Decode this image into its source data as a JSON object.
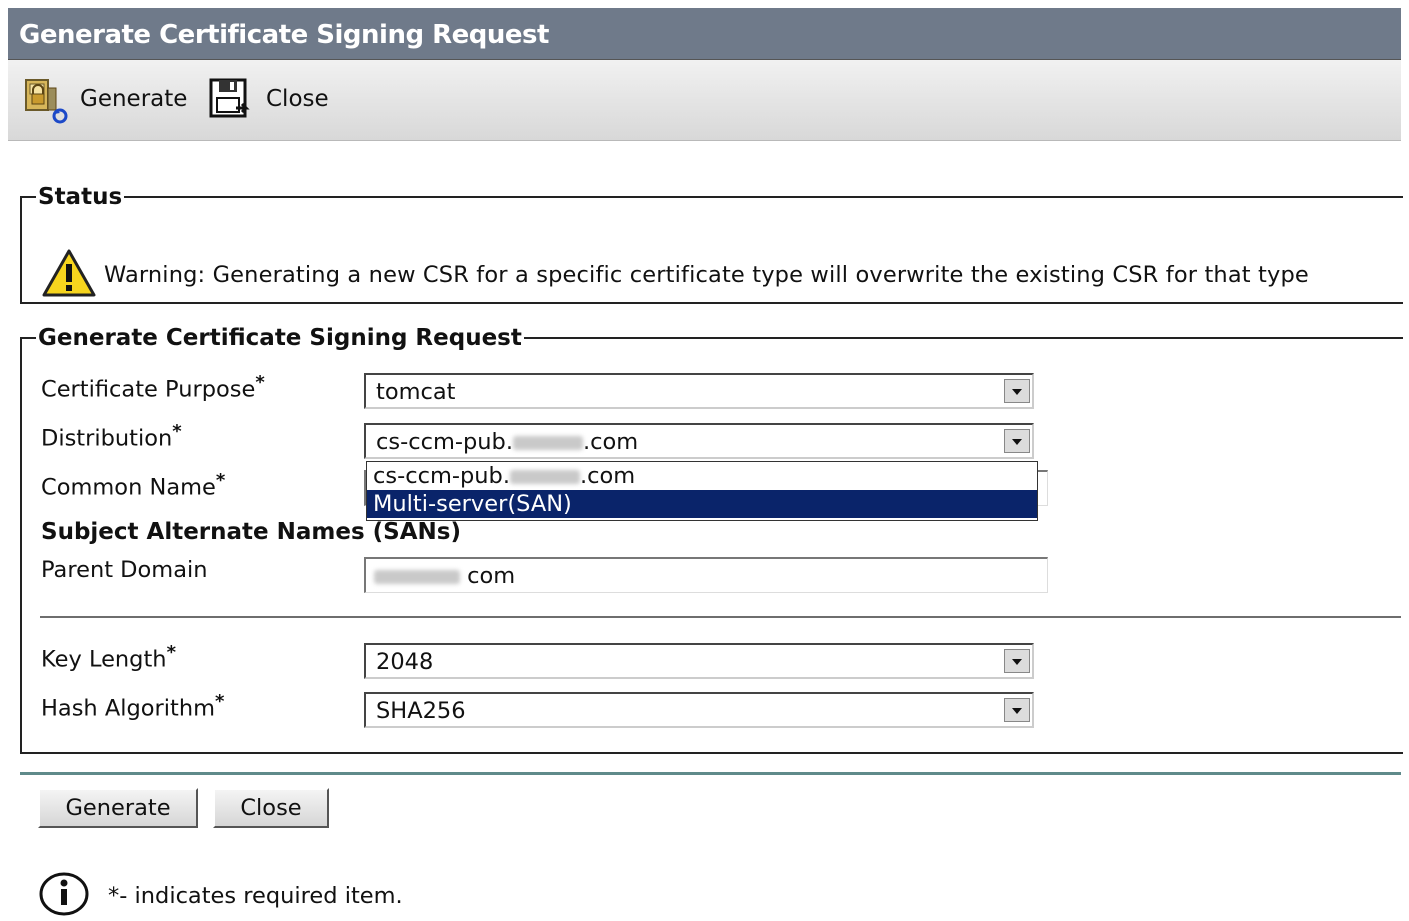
{
  "window": {
    "title": "Generate Certificate Signing Request"
  },
  "toolbar": {
    "generate_label": "Generate",
    "close_label": "Close",
    "generate_icon": "certificate-generate-icon",
    "close_icon": "close-floppy-icon"
  },
  "status": {
    "legend": "Status",
    "warning_icon": "warning-icon",
    "message": "Warning: Generating a new CSR for a specific certificate type will overwrite the existing CSR for that type"
  },
  "csr": {
    "legend": "Generate Certificate Signing Request",
    "certificate_purpose": {
      "label": "Certificate Purpose",
      "value": "tomcat"
    },
    "distribution": {
      "label": "Distribution",
      "value_prefix": "cs-ccm-pub.",
      "value_suffix": ".com",
      "options": [
        {
          "prefix": "cs-ccm-pub.",
          "suffix": ".com",
          "selected": false
        },
        {
          "text": "Multi-server(SAN)",
          "selected": true
        }
      ]
    },
    "common_name": {
      "label": "Common Name",
      "value": ""
    },
    "sans_heading": "Subject Alternate Names (SANs)",
    "parent_domain": {
      "label": "Parent Domain",
      "value_suffix": "com"
    },
    "key_length": {
      "label": "Key Length",
      "value": "2048"
    },
    "hash_algorithm": {
      "label": "Hash Algorithm",
      "value": "SHA256"
    },
    "required_marker": "*"
  },
  "buttons": {
    "generate": "Generate",
    "close": "Close"
  },
  "footer": {
    "info_icon": "info-icon",
    "note": "*- indicates required item."
  }
}
